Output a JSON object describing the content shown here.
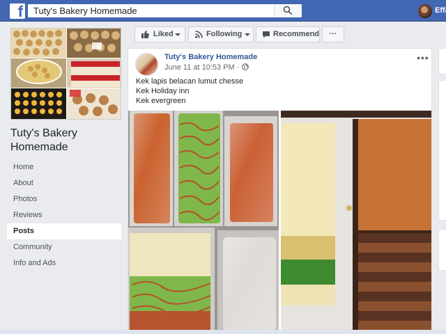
{
  "header": {
    "search_value": "Tuty's Bakery Homemade",
    "user_name": "Effa"
  },
  "page": {
    "name_line1": "Tuty's Bakery",
    "name_line2": "Homemade"
  },
  "nav": {
    "items": [
      {
        "label": "Home"
      },
      {
        "label": "About"
      },
      {
        "label": "Photos"
      },
      {
        "label": "Reviews"
      },
      {
        "label": "Posts"
      },
      {
        "label": "Community"
      },
      {
        "label": "Info and Ads"
      }
    ],
    "active": "Posts"
  },
  "actions": {
    "liked_label": "Liked",
    "following_label": "Following",
    "recommend_label": "Recommend",
    "more_label": "···"
  },
  "post": {
    "author": "Tuty's Bakery Homemade",
    "timestamp": "June 11 at 10:53 PM",
    "separator": "·",
    "more": "•••",
    "lines": [
      "Kek lapis belacan lumut chesse",
      "Kek Holiday inn",
      "Kek evergreen"
    ]
  },
  "colors": {
    "brand_blue": "#4267b2",
    "link_blue": "#365899",
    "background": "#e9ebee"
  }
}
